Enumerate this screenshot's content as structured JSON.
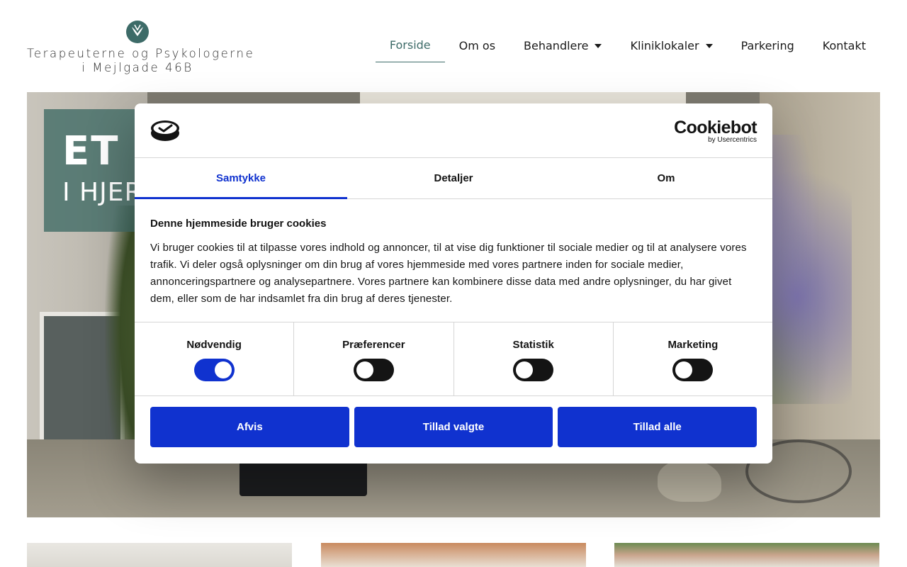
{
  "site": {
    "logo": {
      "line1": "Terapeuterne og Psykologerne",
      "line2": "i Mejlgade 46B",
      "icon": "heart-leaf-logo-icon",
      "color": "#3d6b68"
    },
    "nav": [
      {
        "label": "Forside",
        "active": true,
        "dropdown": false
      },
      {
        "label": "Om os",
        "active": false,
        "dropdown": false
      },
      {
        "label": "Behandlere",
        "active": false,
        "dropdown": true
      },
      {
        "label": "Kliniklokaler",
        "active": false,
        "dropdown": true
      },
      {
        "label": "Parkering",
        "active": false,
        "dropdown": false
      },
      {
        "label": "Kontakt",
        "active": false,
        "dropdown": false
      }
    ],
    "hero": {
      "title": "ET B",
      "subtitle": "I HJER"
    }
  },
  "cookie_dialog": {
    "brand": {
      "name": "Cookiebot",
      "by": "by Usercentrics"
    },
    "tabs": [
      {
        "label": "Samtykke",
        "active": true
      },
      {
        "label": "Detaljer",
        "active": false
      },
      {
        "label": "Om",
        "active": false
      }
    ],
    "heading": "Denne hjemmeside bruger cookies",
    "body": "Vi bruger cookies til at tilpasse vores indhold og annoncer, til at vise dig funktioner til sociale medier og til at analysere vores trafik. Vi deler også oplysninger om din brug af vores hjemmeside med vores partnere inden for sociale medier, annonceringspartnere og analysepartnere. Vores partnere kan kombinere disse data med andre oplysninger, du har givet dem, eller som de har indsamlet fra din brug af deres tjenester.",
    "toggles": [
      {
        "label": "Nødvendig",
        "on": true
      },
      {
        "label": "Præferencer",
        "on": false
      },
      {
        "label": "Statistik",
        "on": false
      },
      {
        "label": "Marketing",
        "on": false
      }
    ],
    "buttons": {
      "reject": "Afvis",
      "allow_selected": "Tillad valgte",
      "allow_all": "Tillad alle"
    },
    "accent_color": "#1032cf"
  }
}
